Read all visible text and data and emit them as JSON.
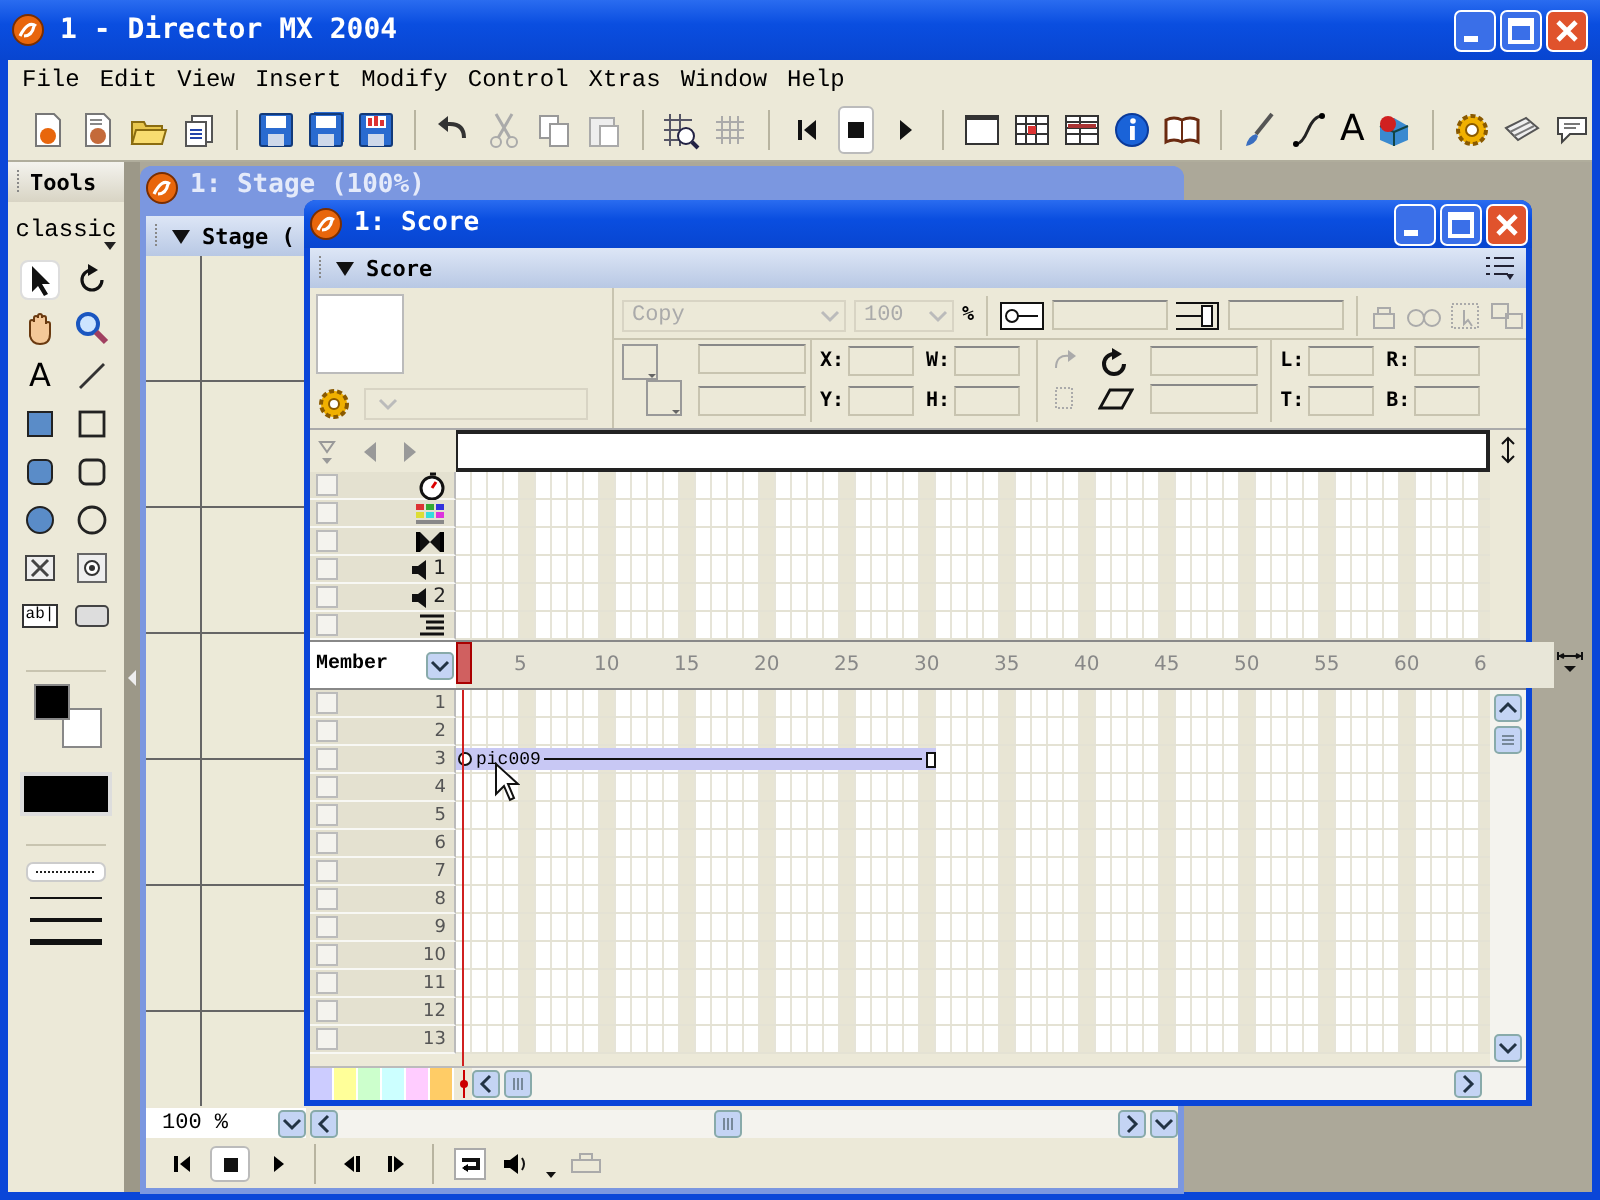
{
  "window": {
    "title": "1 - Director MX 2004"
  },
  "menu": [
    {
      "label": "File"
    },
    {
      "label": "Edit"
    },
    {
      "label": "View"
    },
    {
      "label": "Insert"
    },
    {
      "label": "Modify"
    },
    {
      "label": "Control"
    },
    {
      "label": "Xtras"
    },
    {
      "label": "Window"
    },
    {
      "label": "Help"
    }
  ],
  "toolbar": {
    "text_tool": "A"
  },
  "tools_panel": {
    "title": "Tools",
    "mode": "classic",
    "text_tool": "A",
    "field_tool": "ab|"
  },
  "stage_window": {
    "title": "1: Stage (100%)",
    "panel_title": "Stage (",
    "zoom": "100 %"
  },
  "score_window": {
    "title": "1: Score",
    "panel_title": "Score",
    "ink": "Copy",
    "blend": "100",
    "blend_unit": "%",
    "position_labels": [
      "X:",
      "W:",
      "Y:",
      "H:"
    ],
    "edge_labels": [
      "L:",
      "R:",
      "T:",
      "B:"
    ],
    "special_channels": [
      {
        "kind": "tempo"
      },
      {
        "kind": "palette"
      },
      {
        "kind": "transition"
      },
      {
        "kind": "sound",
        "label": "1"
      },
      {
        "kind": "sound",
        "label": "2"
      },
      {
        "kind": "script"
      }
    ],
    "channel_menu": "Member",
    "frame_numbers": [
      "5",
      "10",
      "15",
      "20",
      "25",
      "30",
      "35",
      "40",
      "45",
      "50",
      "55",
      "60",
      "6"
    ],
    "sprite_channels": [
      {
        "number": "1"
      },
      {
        "number": "2"
      },
      {
        "number": "3",
        "sprite": {
          "label": "pic009"
        }
      },
      {
        "number": "4"
      },
      {
        "number": "5"
      },
      {
        "number": "6"
      },
      {
        "number": "7"
      },
      {
        "number": "8"
      },
      {
        "number": "9"
      },
      {
        "number": "10"
      },
      {
        "number": "11"
      },
      {
        "number": "12"
      },
      {
        "number": "13"
      }
    ],
    "label_colors": [
      {
        "color": "#ccccff"
      },
      {
        "color": "#ffff99"
      },
      {
        "color": "#ccffcc"
      },
      {
        "color": "#ccffff"
      },
      {
        "color": "#ffccff"
      },
      {
        "color": "#ffcc66"
      }
    ]
  }
}
